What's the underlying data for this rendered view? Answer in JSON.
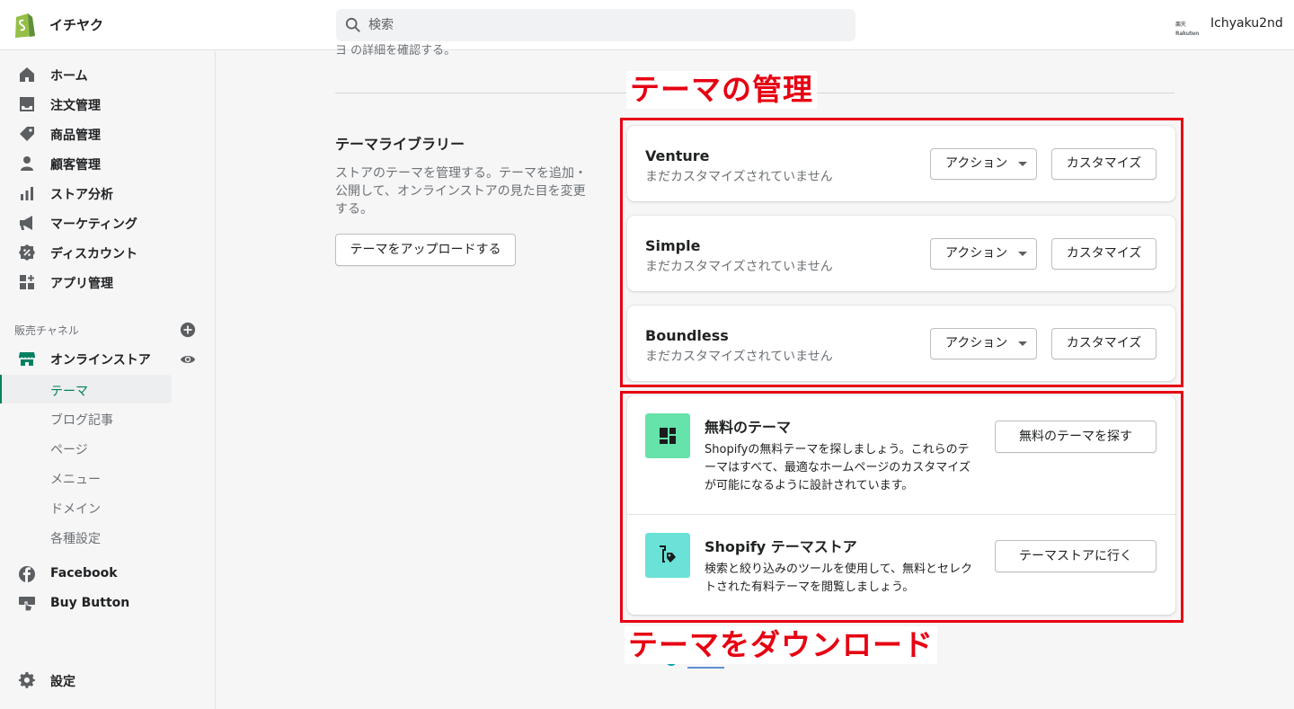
{
  "header": {
    "store_name": "イチヤク",
    "search_placeholder": "検索",
    "user_logo_text": "楽天 Rakuten",
    "user_name": "Ichyaku2nd"
  },
  "sidebar": {
    "items": [
      {
        "label": "ホーム",
        "icon": "home-icon"
      },
      {
        "label": "注文管理",
        "icon": "orders-icon"
      },
      {
        "label": "商品管理",
        "icon": "tag-icon"
      },
      {
        "label": "顧客管理",
        "icon": "customer-icon"
      },
      {
        "label": "ストア分析",
        "icon": "analytics-icon"
      },
      {
        "label": "マーケティング",
        "icon": "megaphone-icon"
      },
      {
        "label": "ディスカウント",
        "icon": "discount-icon"
      },
      {
        "label": "アプリ管理",
        "icon": "apps-icon"
      }
    ],
    "channels_title": "販売チャネル",
    "online_store": "オンラインストア",
    "sub_items": [
      "テーマ",
      "ブログ記事",
      "ページ",
      "メニュー",
      "ドメイン",
      "各種設定"
    ],
    "facebook": "Facebook",
    "buy_button": "Buy Button",
    "settings": "設定"
  },
  "main": {
    "partial_top_text": "ヨ  の詳細を確認する。",
    "library_title": "テーマライブラリー",
    "library_desc": "ストアのテーマを管理する。テーマを追加・公開して、オンラインストアの見た目を変更する。",
    "upload_button": "テーマをアップロードする",
    "themes": [
      {
        "name": "Venture",
        "status": "まだカスタマイズされていません",
        "action": "アクション",
        "customize": "カスタマイズ"
      },
      {
        "name": "Simple",
        "status": "まだカスタマイズされていません",
        "action": "アクション",
        "customize": "カスタマイズ"
      },
      {
        "name": "Boundless",
        "status": "まだカスタマイズされていません",
        "action": "アクション",
        "customize": "カスタマイズ"
      }
    ],
    "free_themes": {
      "title": "無料のテーマ",
      "desc": "Shopifyの無料テーマを探しましょう。これらのテーマはすべて、最適なホームページのカスタマイズが可能になるように設計されています。",
      "button": "無料のテーマを探す",
      "icon_color": "#66e3aa"
    },
    "theme_store": {
      "title": "Shopify テーマストア",
      "desc": "検索と絞り込みのツールを使用して、無料とセレクトされた有料テーマを閲覧しましょう。",
      "button": "テーマストアに行く",
      "icon_color": "#6ae2d8"
    }
  },
  "annotations": {
    "manage_label": "テーマの管理",
    "download_label": "テーマをダウンロード",
    "color": "#e60012"
  }
}
